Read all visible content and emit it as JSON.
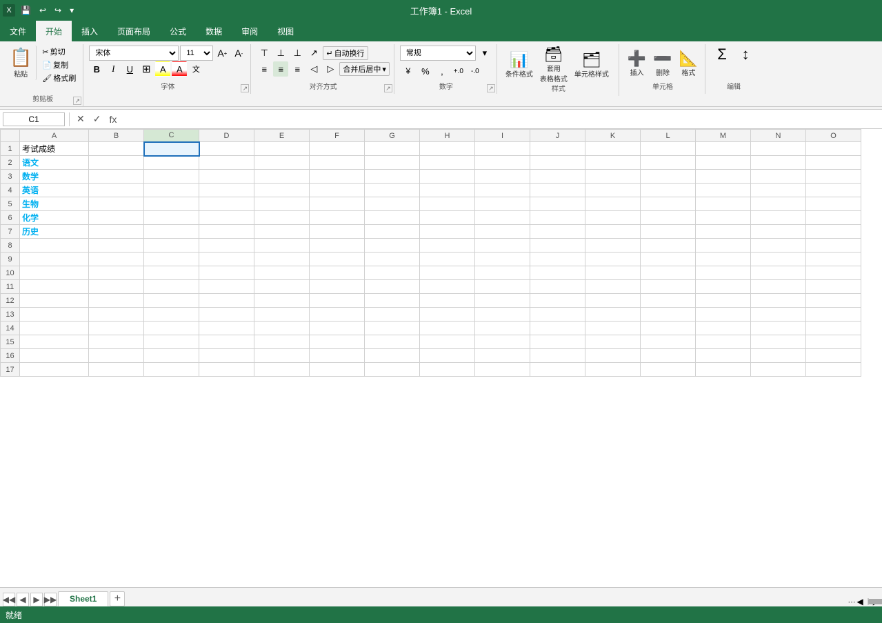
{
  "titleBar": {
    "title": "工作簿1 - Excel",
    "saveIcon": "💾",
    "undoIcon": "↩",
    "redoIcon": "↪",
    "moreIcon": "▾"
  },
  "ribbonTabs": [
    {
      "id": "file",
      "label": "文件"
    },
    {
      "id": "home",
      "label": "开始",
      "active": true
    },
    {
      "id": "insert",
      "label": "插入"
    },
    {
      "id": "pagelayout",
      "label": "页面布局"
    },
    {
      "id": "formula",
      "label": "公式"
    },
    {
      "id": "data",
      "label": "数据"
    },
    {
      "id": "review",
      "label": "审阅"
    },
    {
      "id": "view",
      "label": "视图"
    }
  ],
  "clipboard": {
    "paste": "粘贴",
    "cut": "剪切",
    "copy": "复制",
    "copyFormat": "格式刷",
    "groupTitle": "剪贴板"
  },
  "font": {
    "name": "宋体",
    "size": "11",
    "bold": "B",
    "italic": "I",
    "underline": "U",
    "borderIcon": "⊞",
    "fillIcon": "A",
    "colorIcon": "A",
    "biggerIcon": "A↑",
    "smallerIcon": "A↓",
    "groupTitle": "字体"
  },
  "alignment": {
    "wrapText": "自动换行",
    "merge": "合并后居中",
    "groupTitle": "对齐方式",
    "alignLeft": "≡",
    "alignCenter": "≡",
    "alignRight": "≡",
    "indentDec": "◁",
    "indentInc": "▷",
    "topAlign": "⊤",
    "midAlign": "⊥",
    "botAlign": "⊥",
    "angleIcon": "↗"
  },
  "number": {
    "format": "常规",
    "percent": "%",
    "comma": ",",
    "decInc": "+.0",
    "decDec": "-.0",
    "groupTitle": "数字"
  },
  "styles": {
    "conditional": "条件格式",
    "tableStyle": "套用\n表格格式",
    "cellStyle": "单元格样式",
    "groupTitle": "样式"
  },
  "cells": {
    "insert": "插入",
    "delete": "删除",
    "format": "格式",
    "groupTitle": "单元格"
  },
  "editing": {
    "autosum": "Σ",
    "groupTitle": "编辑"
  },
  "formulaBar": {
    "cellRef": "C1",
    "cancelBtn": "✕",
    "confirmBtn": "✓",
    "formulaBtn": "fx",
    "value": ""
  },
  "columns": [
    "A",
    "B",
    "C",
    "D",
    "E",
    "F",
    "G",
    "H",
    "I",
    "J",
    "K",
    "L",
    "M",
    "N",
    "O"
  ],
  "rows": [
    1,
    2,
    3,
    4,
    5,
    6,
    7,
    8,
    9,
    10,
    11,
    12,
    13,
    14,
    15,
    16,
    17
  ],
  "cellData": {
    "A1": "考试成绩",
    "A2": "语文",
    "A3": "数学",
    "A4": "英语",
    "A5": "生物",
    "A6": "化学",
    "A7": "历史"
  },
  "cyanRows": [
    2,
    3,
    4,
    5,
    6,
    7
  ],
  "selectedCell": "C1",
  "sheetTabs": [
    {
      "label": "Sheet1",
      "active": true
    }
  ],
  "statusBar": {
    "text": "就绪"
  }
}
